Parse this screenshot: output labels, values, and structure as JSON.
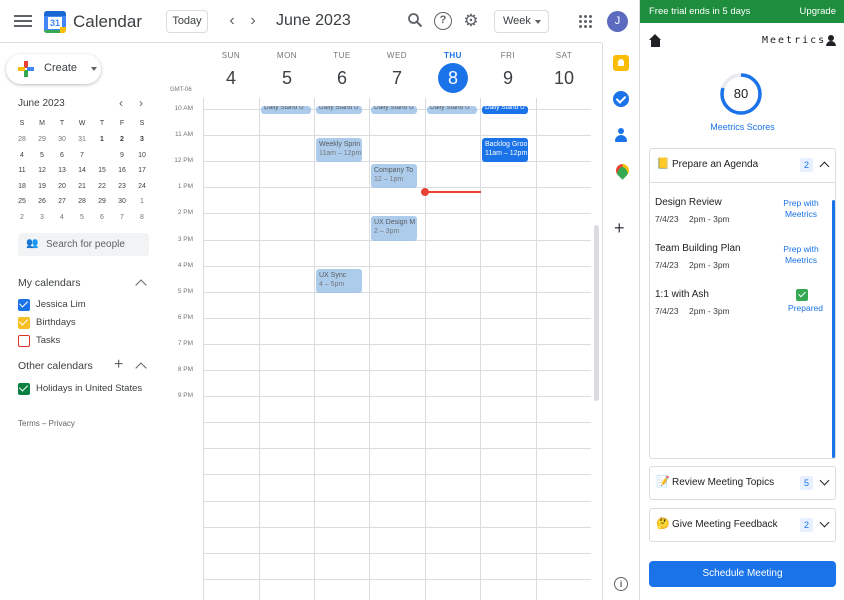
{
  "topbar": {
    "app_title": "Calendar",
    "logo_day": "31",
    "today_label": "Today",
    "month_title": "June 2023",
    "view_label": "Week",
    "avatar_initial": "J"
  },
  "sidebar": {
    "create_label": "Create",
    "mini_month_title": "June 2023",
    "weekday_initials": [
      "S",
      "M",
      "T",
      "W",
      "T",
      "F",
      "S"
    ],
    "mini_weeks": [
      [
        "28",
        "29",
        "30",
        "31",
        "1",
        "2",
        "3"
      ],
      [
        "4",
        "5",
        "6",
        "7",
        "8",
        "9",
        "10"
      ],
      [
        "11",
        "12",
        "13",
        "14",
        "15",
        "16",
        "17"
      ],
      [
        "18",
        "19",
        "20",
        "21",
        "22",
        "23",
        "24"
      ],
      [
        "25",
        "26",
        "27",
        "28",
        "29",
        "30",
        "1"
      ],
      [
        "2",
        "3",
        "4",
        "5",
        "6",
        "7",
        "8"
      ]
    ],
    "search_people_placeholder": "Search for people",
    "my_calendars_title": "My calendars",
    "my_calendars": [
      {
        "name": "Jessica Lim",
        "color": "#1a73e8",
        "checked": true
      },
      {
        "name": "Birthdays",
        "color": "#f6bf26",
        "checked": true
      },
      {
        "name": "Tasks",
        "color": "#d93025",
        "checked": false
      }
    ],
    "other_calendars_title": "Other calendars",
    "other_calendars": [
      {
        "name": "Holidays in United States",
        "color": "#0b8043",
        "checked": true
      }
    ],
    "footer": "Terms – Privacy"
  },
  "week": {
    "days": [
      {
        "name": "SUN",
        "num": "4"
      },
      {
        "name": "MON",
        "num": "5"
      },
      {
        "name": "TUE",
        "num": "6"
      },
      {
        "name": "WED",
        "num": "7"
      },
      {
        "name": "THU",
        "num": "8",
        "active": true
      },
      {
        "name": "FRI",
        "num": "9"
      },
      {
        "name": "SAT",
        "num": "10"
      }
    ],
    "timezone": "GMT-06",
    "hours": [
      "10 AM",
      "11 AM",
      "12 PM",
      "1 PM",
      "2 PM",
      "3 PM",
      "4 PM",
      "5 PM",
      "6 PM",
      "7 PM",
      "8 PM",
      "9 PM"
    ],
    "events": [
      {
        "day": 1,
        "title": "Daily Stand U",
        "time": "",
        "start": 9.75,
        "end": 10.0,
        "style": "pale"
      },
      {
        "day": 2,
        "title": "Daily Stand U",
        "time": "",
        "start": 9.75,
        "end": 10.0,
        "style": "pale"
      },
      {
        "day": 3,
        "title": "Daily Stand U",
        "time": "",
        "start": 9.75,
        "end": 10.0,
        "style": "pale"
      },
      {
        "day": 4,
        "title": "Daily Stand U",
        "time": "",
        "start": 9.75,
        "end": 10.0,
        "style": "pale"
      },
      {
        "day": 5,
        "title": "Daily Stand U",
        "time": "",
        "start": 9.75,
        "end": 10.0,
        "style": "strong"
      },
      {
        "day": 2,
        "title": "Weekly Sprin",
        "time": "11am – 12pm",
        "start": 11.0,
        "end": 12.0,
        "style": "pale"
      },
      {
        "day": 5,
        "title": "Backlog Groo",
        "time": "11am – 12pm",
        "start": 11.0,
        "end": 12.0,
        "style": "strong"
      },
      {
        "day": 3,
        "title": "Company To",
        "time": "12 – 1pm",
        "start": 12.0,
        "end": 13.0,
        "style": "pale"
      },
      {
        "day": 3,
        "title": "UX Design M",
        "time": "2 – 3pm",
        "start": 14.0,
        "end": 15.0,
        "style": "pale"
      },
      {
        "day": 2,
        "title": "UX Sync",
        "time": "4 – 5pm",
        "start": 16.0,
        "end": 17.0,
        "style": "pale"
      }
    ]
  },
  "panel": {
    "trial_text": "Free trial ends in 5 days",
    "upgrade_label": "Upgrade",
    "brand": "Meetrics",
    "score": "80",
    "score_value": 80,
    "score_label": "Meetrics Scores",
    "agenda": {
      "emoji": "📒",
      "title": "Prepare an Agenda",
      "count": "2",
      "meetings": [
        {
          "name": "Design Review",
          "date": "7/4/23",
          "time": "2pm - 3pm",
          "action": "Prep with Meetrics"
        },
        {
          "name": "Team Building Plan",
          "date": "7/4/23",
          "time": "2pm - 3pm",
          "action": "Prep with Meetrics"
        },
        {
          "name": "1:1 with Ash",
          "date": "7/4/23",
          "time": "2pm - 3pm",
          "action": "Prepared"
        }
      ]
    },
    "topics": {
      "emoji": "📝",
      "title": "Review Meeting Topics",
      "count": "5"
    },
    "feedback": {
      "emoji": "🤔",
      "title": "Give Meeting Feedback",
      "count": "2"
    },
    "schedule_label": "Schedule Meeting"
  }
}
